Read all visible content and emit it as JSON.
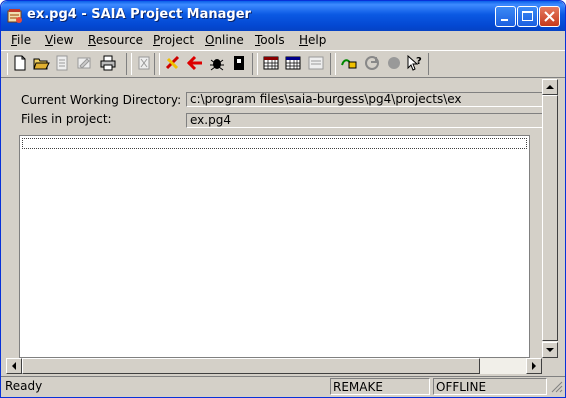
{
  "window": {
    "title": "ex.pg4 - SAIA Project Manager",
    "icon": "saia-app-icon"
  },
  "menu": [
    {
      "key": "F",
      "rest": "ile"
    },
    {
      "key": "V",
      "rest": "iew"
    },
    {
      "key": "R",
      "rest": "esource"
    },
    {
      "key": "P",
      "rest": "roject"
    },
    {
      "key": "O",
      "rest": "nline"
    },
    {
      "key": "T",
      "rest": "ools"
    },
    {
      "key": "H",
      "rest": "elp"
    }
  ],
  "toolbar": {
    "icons": [
      "new-icon",
      "open-icon",
      "properties-icon",
      "edit-icon",
      "print-icon",
      "delete-icon",
      "build-icon",
      "rebuild-icon",
      "debug-icon",
      "download-icon",
      "calendar-icon",
      "table-icon",
      "compare-icon",
      "connect-icon",
      "run-icon",
      "stop-icon",
      "help-pointer-icon"
    ]
  },
  "main": {
    "cwd_label": "Current Working Directory:",
    "cwd_value": "c:\\program files\\saia-burgess\\pg4\\projects\\ex",
    "files_label": "Files in project:",
    "files_value": "ex.pg4",
    "file_list": []
  },
  "status": {
    "text": "Ready",
    "remake": "REMAKE",
    "online_state": "OFFLINE"
  }
}
